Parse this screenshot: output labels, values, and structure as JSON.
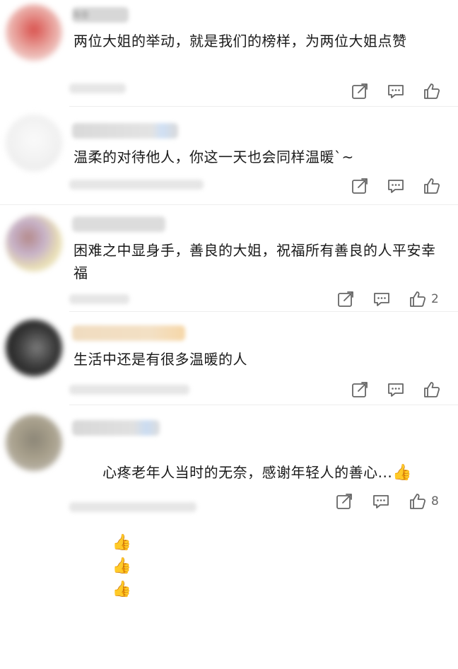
{
  "comments": [
    {
      "username": "海音",
      "text": "两位大姐的举动，就是我们的榜样，为两位大姐点赞",
      "like_count": ""
    },
    {
      "username": "",
      "text": "温柔的对待他人，你这一天也会同样温暖`~",
      "like_count": ""
    },
    {
      "username": "",
      "text": "困难之中显身手，善良的大姐，祝福所有善良的人平安幸福",
      "like_count": "2"
    },
    {
      "username": "",
      "text": "生活中还是有很多温暖的人",
      "like_count": ""
    },
    {
      "username": "",
      "text": "心疼老年人当时的无奈，感谢年轻人的善心...",
      "like_count": "8"
    }
  ],
  "emoji": {
    "thumbs_up": "👍"
  },
  "icons": {
    "share": "share-icon",
    "comment": "comment-icon",
    "like": "like-icon"
  },
  "colors": {
    "text": "#1a1a1a",
    "icon": "#666666",
    "divider": "#eeeeee"
  }
}
